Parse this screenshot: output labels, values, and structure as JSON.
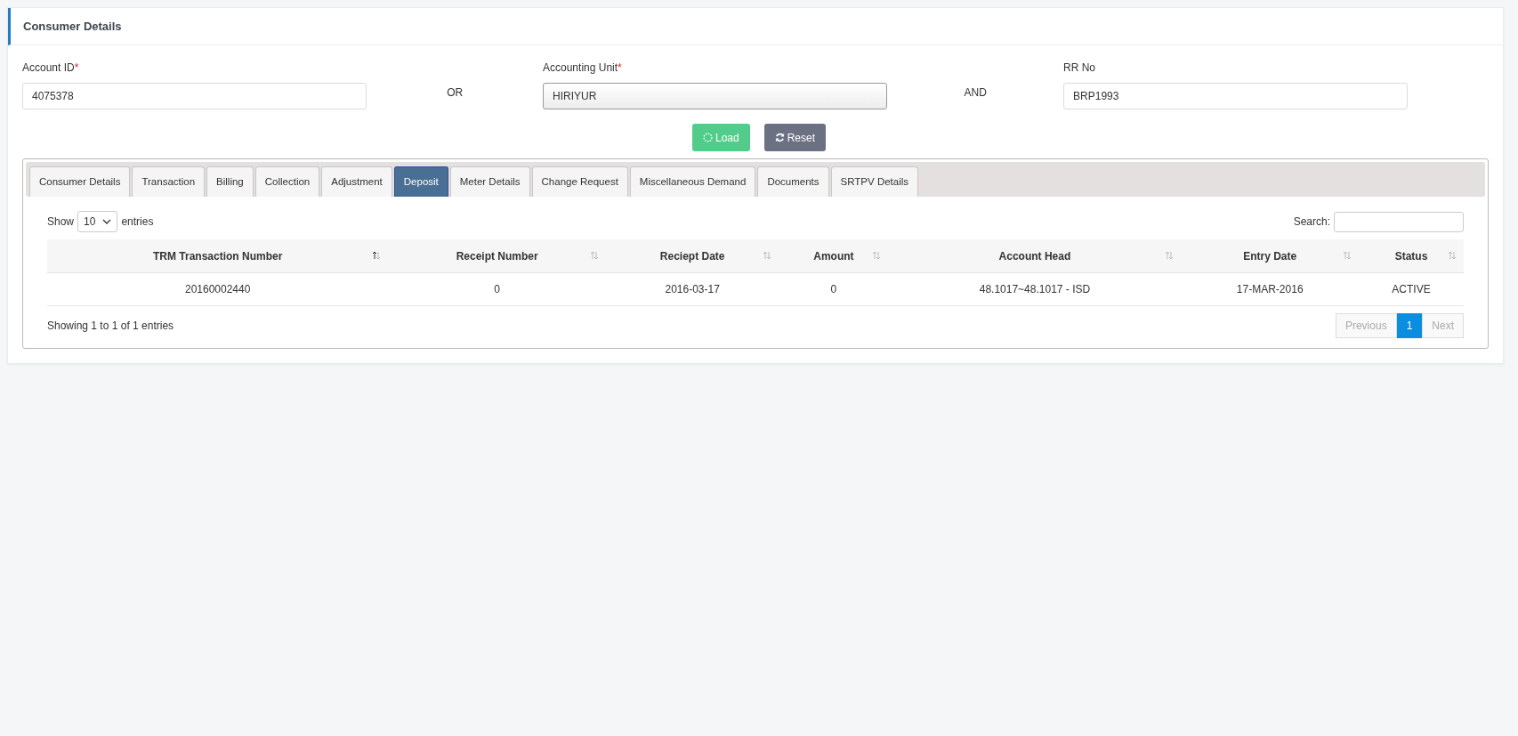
{
  "card": {
    "title": "Consumer Details"
  },
  "filters": [
    {
      "kind": "text",
      "label": "Account ID",
      "required_mark": "*",
      "value": "4075378"
    },
    {
      "kind": "connector",
      "text": "OR"
    },
    {
      "kind": "select",
      "label": "Accounting Unit",
      "required_mark": "*",
      "value": "HIRIYUR"
    },
    {
      "kind": "connector",
      "text": "AND"
    },
    {
      "kind": "text",
      "label": "RR No",
      "value": "BRP1993"
    }
  ],
  "buttons": [
    {
      "kind": "load",
      "label": "Load"
    },
    {
      "kind": "reset",
      "label": "Reset"
    }
  ],
  "tabs": [
    {
      "label": "Consumer Details",
      "selected": false
    },
    {
      "label": "Transaction",
      "selected": false
    },
    {
      "label": "Billing",
      "selected": false
    },
    {
      "label": "Collection",
      "selected": false
    },
    {
      "label": "Adjustment",
      "selected": false
    },
    {
      "label": "Deposit",
      "selected": true
    },
    {
      "label": "Meter Details",
      "selected": false
    },
    {
      "label": "Change Request",
      "selected": false
    },
    {
      "label": "Miscellaneous Demand",
      "selected": false
    },
    {
      "label": "Documents",
      "selected": false
    },
    {
      "label": "SRTPV Details",
      "selected": false
    }
  ],
  "length_menu": {
    "before": "Show",
    "value": "10",
    "after": "entries"
  },
  "search": {
    "label": "Search:"
  },
  "table": {
    "columns": [
      {
        "label": "TRM Transaction Number",
        "sorted": true
      },
      {
        "label": "Receipt Number",
        "sorted": false
      },
      {
        "label": "Reciept Date",
        "sorted": false
      },
      {
        "label": "Amount",
        "sorted": false
      },
      {
        "label": "Account Head",
        "sorted": false
      },
      {
        "label": "Entry Date",
        "sorted": false
      },
      {
        "label": "Status",
        "sorted": false
      }
    ],
    "rows": [
      [
        "20160002440",
        "0",
        "2016-03-17",
        "0",
        "48.1017~48.1017 - ISD",
        "17-MAR-2016",
        "ACTIVE"
      ]
    ]
  },
  "info": "Showing 1 to 1 of 1 entries",
  "pagination": [
    {
      "label": "Previous",
      "disabled": true,
      "selected": false
    },
    {
      "label": "1",
      "disabled": false,
      "selected": true
    },
    {
      "label": "Next",
      "disabled": true,
      "selected": false
    }
  ]
}
